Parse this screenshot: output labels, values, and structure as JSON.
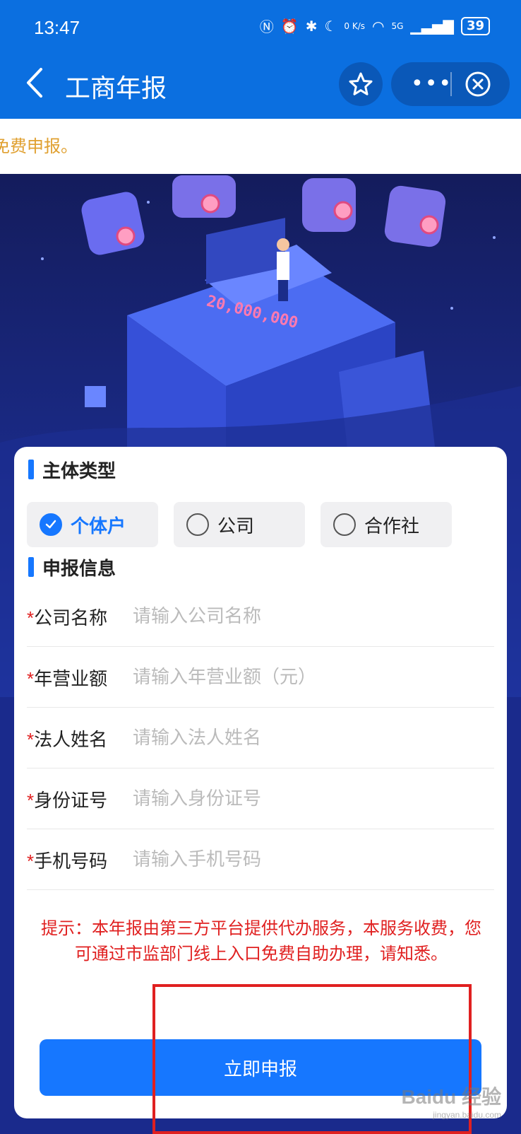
{
  "status_bar": {
    "time": "13:47",
    "net_speed": "0 K/s",
    "signal": "5G",
    "battery": "39"
  },
  "nav": {
    "title": "工商年报"
  },
  "notice": {
    "text": "免费申报。"
  },
  "hero": {
    "counter": "20,000,000"
  },
  "form": {
    "type_section_title": "主体类型",
    "types": [
      {
        "label": "个体户",
        "selected": true
      },
      {
        "label": "公司",
        "selected": false
      },
      {
        "label": "合作社",
        "selected": false
      }
    ],
    "info_section_title": "申报信息",
    "required_mark": "*",
    "fields": [
      {
        "label": "公司名称",
        "placeholder": "请输入公司名称"
      },
      {
        "label": "年营业额",
        "placeholder": "请输入年营业额（元）"
      },
      {
        "label": "法人姓名",
        "placeholder": "请输入法人姓名"
      },
      {
        "label": "身份证号",
        "placeholder": "请输入身份证号"
      },
      {
        "label": "手机号码",
        "placeholder": "请输入手机号码"
      }
    ],
    "tip": "提示：本年报由第三方平台提供代办服务，本服务收费，您可通过市监部门线上入口免费自助办理，请知悉。",
    "submit_label": "立即申报"
  },
  "watermark": {
    "text": "Baidu 经验",
    "subtext": "jingyan.baidu.com"
  },
  "colors": {
    "primary": "#1677ff",
    "nav_bg": "#0b6fe0",
    "tip_red": "#e02020",
    "notice_orange": "#e0a030"
  }
}
